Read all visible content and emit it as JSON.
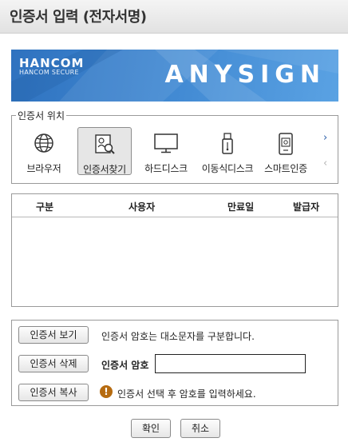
{
  "window": {
    "title": "인증서 입력 (전자서명)"
  },
  "banner": {
    "logo": "HANCOM",
    "logo_sub": "HANCOM SECURE",
    "product": "ANYSIGN",
    "colors": {
      "start": "#2f72bf",
      "end": "#5aa2e3"
    }
  },
  "location": {
    "legend": "인증서 위치",
    "items": [
      {
        "label": "브라우저",
        "icon": "globe-icon"
      },
      {
        "label": "인증서찾기",
        "icon": "certificate-search-icon",
        "selected": true
      },
      {
        "label": "하드디스크",
        "icon": "monitor-icon"
      },
      {
        "label": "이동식디스크",
        "icon": "usb-drive-icon"
      },
      {
        "label": "스마트인증",
        "icon": "smartphone-icon"
      }
    ],
    "next_arrow": "›",
    "prev_arrow": "‹"
  },
  "cert_table": {
    "columns": [
      "구분",
      "사용자",
      "만료일",
      "발급자"
    ],
    "rows": []
  },
  "actions": {
    "view_button": "인증서 보기",
    "delete_button": "인증서 삭제",
    "copy_button": "인증서 복사",
    "case_notice": "인증서 암호는 대소문자를 구분합니다.",
    "password_label": "인증서 암호",
    "password_value": "",
    "hint": "인증서 선택 후 암호를 입력하세요.",
    "warn_color": "#b66b10"
  },
  "footer": {
    "ok_button": "확인",
    "cancel_button": "취소"
  }
}
